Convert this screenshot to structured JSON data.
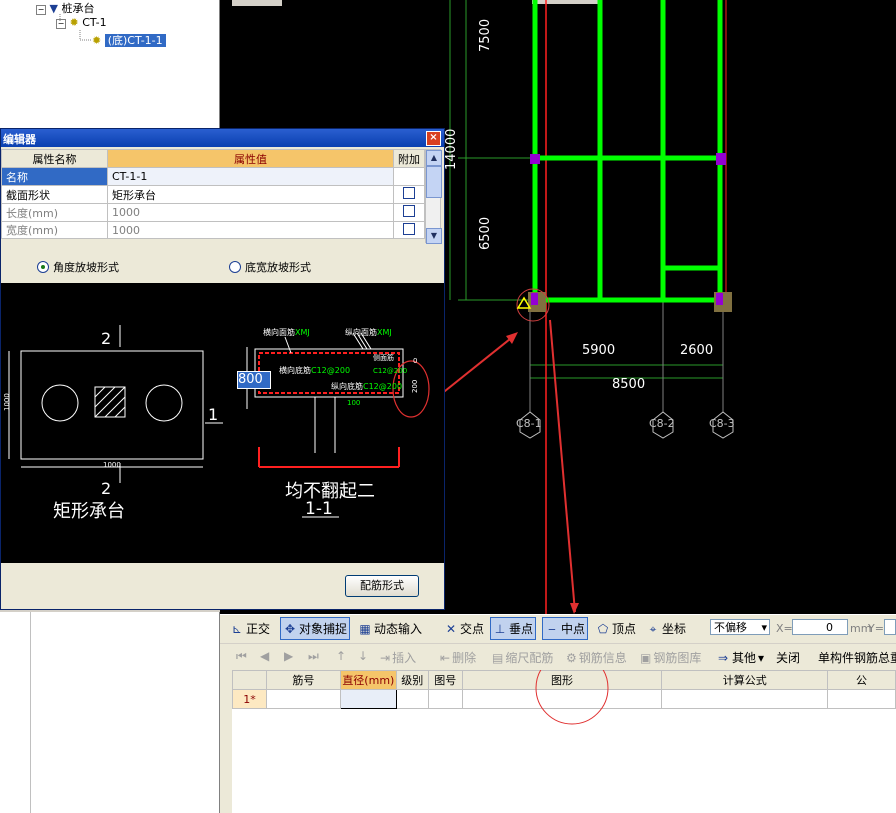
{
  "tree": {
    "root": "桩承台",
    "child": "CT-1",
    "leaf": "(底)CT-1-1"
  },
  "dialog": {
    "title": "编辑器",
    "close": "×",
    "headers": {
      "name": "属性名称",
      "value": "属性值",
      "extra": "附加"
    },
    "rows": [
      {
        "name": "名称",
        "value": "CT-1-1",
        "check": false
      },
      {
        "name": "截面形状",
        "value": "矩形承台",
        "check": true
      },
      {
        "name": "长度(mm)",
        "value": "1000",
        "check": true
      },
      {
        "name": "宽度(mm)",
        "value": "1000",
        "check": true
      }
    ],
    "radio_angle": "角度放坡形式",
    "radio_width": "底宽放坡形式",
    "rebar_button": "配筋形式"
  },
  "preview": {
    "label_2_top": "2",
    "label_1_right": "1",
    "label_2_bottom": "2",
    "dim_1000_side": "1000",
    "dim_1000_bottom": "1000",
    "caption_left": "矩形承台",
    "top_label_a": "横向面筋",
    "top_label_b": "纵向面筋",
    "top_tag_a": "XMJ",
    "top_tag_b": "XMJ",
    "mid_label_a": "横向底筋",
    "mid_value_a": "C12@200",
    "mid_label_b": "纵向底筋",
    "mid_value_b": "C12@200",
    "side_label": "侧面筋",
    "side_value": "C12@200",
    "edit_value": "800",
    "dim_0": "0",
    "dim_200": "200",
    "dim_100": "100",
    "caption_right": "均不翻起二",
    "section": "1-1"
  },
  "cad": {
    "dim_7500": "7500",
    "dim_14000": "14000",
    "dim_6500": "6500",
    "dim_5900": "5900",
    "dim_2600": "2600",
    "dim_8500": "8500",
    "axis_c8_1": "C8-1",
    "axis_c8_2": "C8-2",
    "axis_c8_3": "C8-3"
  },
  "toolbar1": {
    "orth": "正交",
    "snap": "对象捕捉",
    "dyn": "动态输入",
    "inter": "交点",
    "perp": "垂点",
    "mid": "中点",
    "vert": "顶点",
    "coord": "坐标",
    "offset": "不偏移",
    "x_label": "X=",
    "x_value": "0",
    "mm": "mm",
    "y_label": "Y="
  },
  "toolbar2": {
    "insert": "插入",
    "delete": "删除",
    "scale": "缩尺配筋",
    "info": "钢筋信息",
    "lib": "钢筋图库",
    "other": "其他",
    "close": "关闭",
    "total": "单构件钢筋总重"
  },
  "grid": {
    "headers": [
      "筋号",
      "直径(mm)",
      "级别",
      "图号",
      "图形",
      "计算公式",
      "公"
    ],
    "row1": "1*"
  },
  "colors": {
    "green": "#00ff00",
    "magenta": "#9400d3",
    "red_annot": "#e03030"
  }
}
